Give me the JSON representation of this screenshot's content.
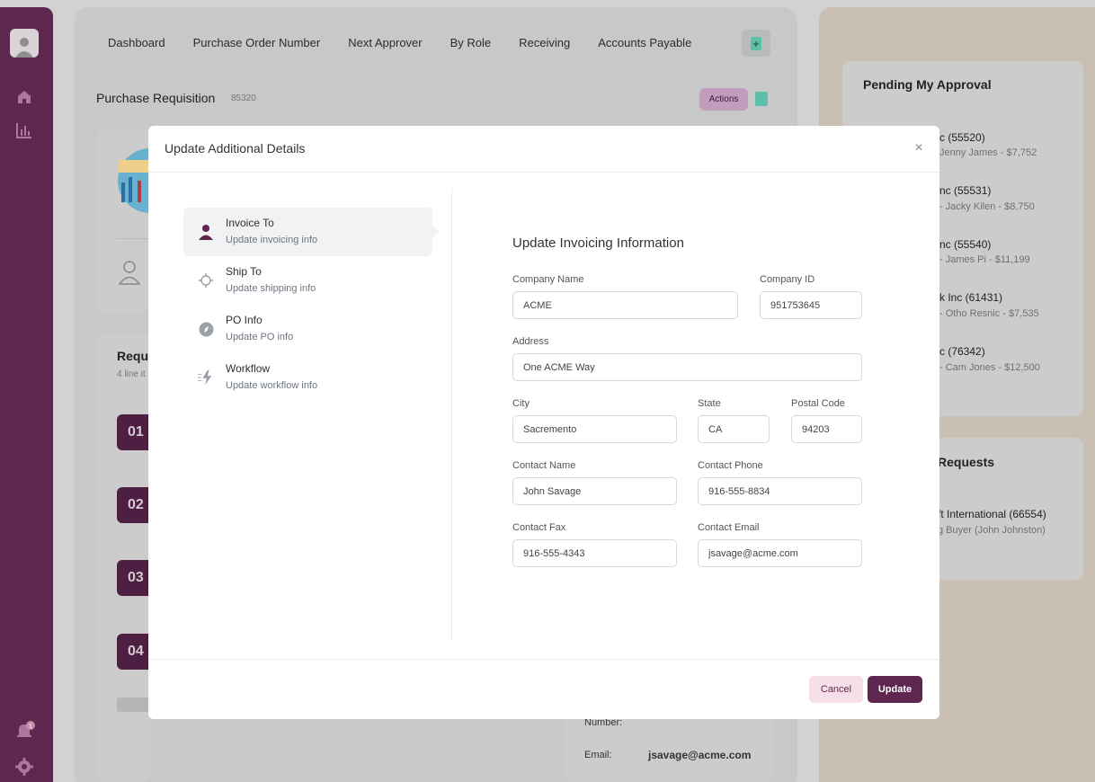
{
  "nav": {
    "items": [
      "Dashboard",
      "Purchase Order Number",
      "Next Approver",
      "By Role",
      "Receiving",
      "Accounts Payable"
    ]
  },
  "page": {
    "title": "Purchase Requisition",
    "number": "85320",
    "actions_label": "Actions",
    "requests_title": "Requ",
    "requests_sub": "4 line it",
    "line_labels": [
      "01",
      "02",
      "03",
      "04"
    ],
    "bottom_number_label": "Number:",
    "bottom_email_label": "Email:",
    "bottom_email_value": "jsavage@acme.com"
  },
  "sidebar": {
    "notification_count": "1"
  },
  "pending": {
    "title": "Pending My Approval",
    "items": [
      {
        "name": "c (55520)",
        "detail": "Jenny James - $7,752"
      },
      {
        "name": "nc (55531)",
        "detail": "- Jacky Kilen - $8,750"
      },
      {
        "name": "nc (55540)",
        "detail": "- James Pi - $11,199"
      },
      {
        "name": "k Inc (61431)",
        "detail": "- Otho Resnic - $7,535"
      },
      {
        "name": "c (76342)",
        "detail": "- Cam Jones - $12,500"
      }
    ]
  },
  "requests": {
    "title": "Requests",
    "item_name": "ft International (66554)",
    "item_detail": "g Buyer (John Johnston)"
  },
  "modal": {
    "title": "Update Additional Details",
    "close_label": "×",
    "steps": [
      {
        "title": "Invoice To",
        "sub": "Update invoicing info"
      },
      {
        "title": "Ship To",
        "sub": "Update shipping info"
      },
      {
        "title": "PO Info",
        "sub": "Update PO info"
      },
      {
        "title": "Workflow",
        "sub": "Update workflow info"
      }
    ],
    "form": {
      "title": "Update Invoicing Information",
      "company_name_label": "Company Name",
      "company_name": "ACME",
      "company_id_label": "Company ID",
      "company_id": "951753645",
      "address_label": "Address",
      "address": "One ACME Way",
      "city_label": "City",
      "city": "Sacremento",
      "state_label": "State",
      "state": "CA",
      "postal_label": "Postal Code",
      "postal": "94203",
      "contact_name_label": "Contact Name",
      "contact_name": "John Savage",
      "contact_phone_label": "Contact Phone",
      "contact_phone": "916-555-8834",
      "contact_fax_label": "Contact Fax",
      "contact_fax": "916-555-4343",
      "contact_email_label": "Contact Email",
      "contact_email": "jsavage@acme.com"
    },
    "cancel_label": "Cancel",
    "update_label": "Update"
  },
  "colors": {
    "brand": "#5e2750",
    "overlay": "#d2d2d2",
    "accent_teal": "#5dbfa8"
  }
}
